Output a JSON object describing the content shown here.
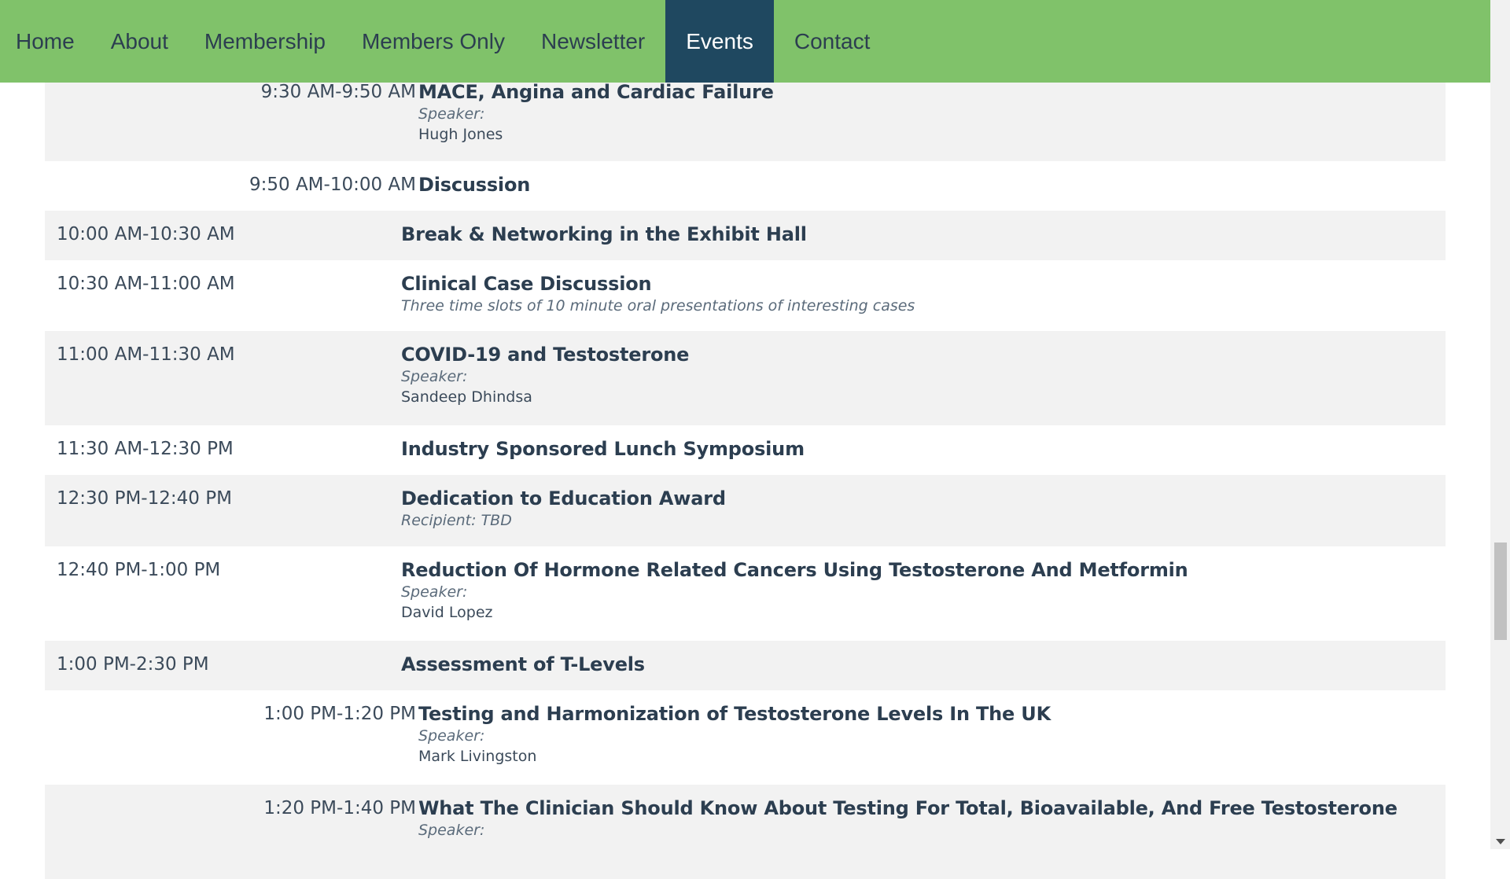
{
  "nav": {
    "items": [
      {
        "label": "Home",
        "active": false
      },
      {
        "label": "About",
        "active": false
      },
      {
        "label": "Membership",
        "active": false
      },
      {
        "label": "Members Only",
        "active": false
      },
      {
        "label": "Newsletter",
        "active": false
      },
      {
        "label": "Events",
        "active": true
      },
      {
        "label": "Contact",
        "active": false
      }
    ]
  },
  "schedule": {
    "rows": [
      {
        "time": "9:30 AM-9:50 AM",
        "title": "MACE, Angina and Cardiac Failure",
        "speaker_label": "Speaker:",
        "speaker": "Hugh Jones"
      },
      {
        "time": "9:50 AM-10:00 AM",
        "title": "Discussion"
      },
      {
        "time": "10:00 AM-10:30 AM",
        "title": "Break & Networking in the Exhibit Hall"
      },
      {
        "time": "10:30 AM-11:00 AM",
        "title": "Clinical Case Discussion",
        "note": "Three time slots of 10 minute oral presentations of interesting cases"
      },
      {
        "time": "11:00 AM-11:30 AM",
        "title": "COVID-19 and Testosterone",
        "speaker_label": "Speaker:",
        "speaker": "Sandeep Dhindsa"
      },
      {
        "time": "11:30 AM-12:30 PM",
        "title": "Industry Sponsored Lunch Symposium"
      },
      {
        "time": "12:30 PM-12:40 PM",
        "title": "Dedication to Education Award",
        "note": "Recipient: TBD"
      },
      {
        "time": "12:40 PM-1:00 PM",
        "title": "Reduction Of Hormone Related Cancers Using Testosterone And Metformin",
        "speaker_label": "Speaker:",
        "speaker": "David Lopez"
      },
      {
        "time": "1:00 PM-2:30 PM",
        "title": "Assessment of T-Levels"
      },
      {
        "time": "1:00 PM-1:20 PM",
        "title": "Testing and Harmonization of Testosterone Levels In The UK",
        "speaker_label": "Speaker:",
        "speaker": "Mark Livingston"
      },
      {
        "time": "1:20 PM-1:40 PM",
        "title": "What The Clinician Should Know About Testing For Total, Bioavailable, And Free Testosterone",
        "speaker_label": "Speaker:"
      }
    ]
  }
}
